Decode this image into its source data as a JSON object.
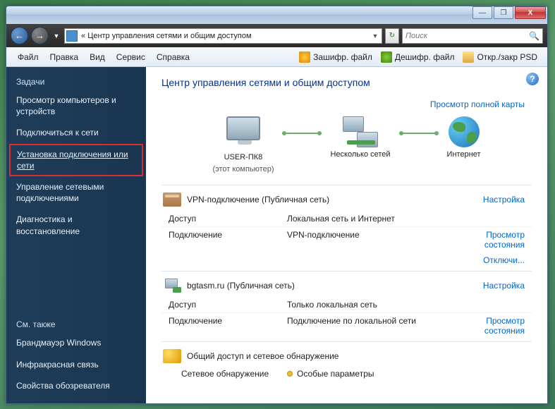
{
  "titlebar": {
    "min_icon": "—",
    "max_icon": "❐",
    "close_icon": "X"
  },
  "nav": {
    "back_icon": "←",
    "fwd_icon": "→",
    "breadcrumb_prefix": "«",
    "breadcrumb": "Центр управления сетями и общим доступом",
    "dd_icon": "▼",
    "refresh_icon": "↻",
    "search_placeholder": "Поиск",
    "search_icon": "🔍"
  },
  "menu": {
    "items": [
      "Файл",
      "Правка",
      "Вид",
      "Сервис",
      "Справка"
    ],
    "tools": {
      "enc": "Зашифр. файл",
      "dec": "Дешифр. файл",
      "psd": "Откр./закр PSD"
    }
  },
  "sidebar": {
    "header": "Задачи",
    "items": [
      "Просмотр компьютеров и устройств",
      "Подключиться к сети",
      "Установка подключения или сети",
      "Управление сетевыми подключениями",
      "Диагностика и восстановление"
    ],
    "also_header": "См. также",
    "also": [
      "Брандмауэр Windows",
      "Инфракрасная связь",
      "Свойства обозревателя"
    ]
  },
  "content": {
    "title": "Центр управления сетями и общим доступом",
    "help": "?",
    "fullmap": "Просмотр полной карты",
    "nodes": {
      "pc": "USER-ПК8",
      "pc_sub": "(этот компьютер)",
      "middle": "Несколько сетей",
      "internet": "Интернет"
    },
    "sections": [
      {
        "title": "VPN-подключение (Публичная сеть)",
        "action": "Настройка",
        "rows": [
          {
            "k": "Доступ",
            "v": "Локальная сеть и Интернет",
            "a": ""
          },
          {
            "k": "Подключение",
            "v": "VPN-подключение",
            "a": "Просмотр состояния"
          },
          {
            "k": "",
            "v": "",
            "a": "Отключи..."
          }
        ]
      },
      {
        "title": "bgtasm.ru (Публичная сеть)",
        "action": "Настройка",
        "rows": [
          {
            "k": "Доступ",
            "v": "Только локальная сеть",
            "a": ""
          },
          {
            "k": "Подключение",
            "v": "Подключение по локальной сети",
            "a": "Просмотр состояния"
          }
        ]
      }
    ],
    "sharing": {
      "title": "Общий доступ и сетевое обнаружение",
      "row_k": "Сетевое обнаружение",
      "row_v": "Особые параметры"
    }
  }
}
